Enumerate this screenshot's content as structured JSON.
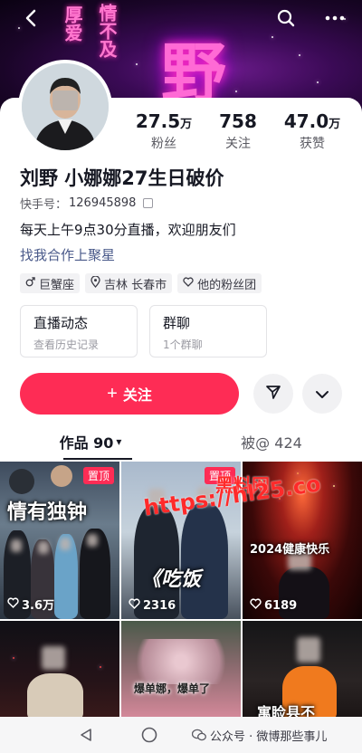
{
  "header": {
    "back_icon": "chevron-left-icon",
    "search_icon": "search-icon",
    "more_icon": "more-horizontal-icon",
    "banner_big_text": "野",
    "banner_text_1": "厚爱",
    "banner_text_2": "情不及"
  },
  "profile": {
    "name": "刘野 小娜娜27生日破价",
    "account_label": "快手号：",
    "account_id": "126945898",
    "bio_line1": "每天上午9点30分直播，欢迎朋友们",
    "bio_line2": "找我合作上聚星",
    "stats": [
      {
        "value": "27.5",
        "unit": "万",
        "label": "粉丝"
      },
      {
        "value": "758",
        "unit": "",
        "label": "关注"
      },
      {
        "value": "47.0",
        "unit": "万",
        "label": "获赞"
      }
    ],
    "tags": [
      {
        "icon": "male-icon",
        "label": "巨蟹座"
      },
      {
        "icon": "location-pin-icon",
        "label": "吉林 长春市"
      },
      {
        "icon": "heart-icon",
        "label": "他的粉丝团"
      }
    ]
  },
  "features": [
    {
      "title": "直播动态",
      "subtitle": "查看历史记录"
    },
    {
      "title": "群聊",
      "subtitle": "1个群聊"
    }
  ],
  "actions": {
    "follow_label": "关注",
    "plus_symbol": "+",
    "share_icon": "send-icon",
    "expand_icon": "chevron-down-icon"
  },
  "tabs": [
    {
      "label": "作品 90",
      "suffix": "▾"
    },
    {
      "label": "被@ 424",
      "suffix": ""
    }
  ],
  "videos": [
    {
      "likes": "3.6万",
      "pinned": "置顶",
      "overlay": "情有独钟"
    },
    {
      "likes": "2316",
      "pinned": "置顶",
      "overlay": "《吃饭"
    },
    {
      "likes": "6189",
      "pinned": "",
      "overlay": "2024健康快乐"
    },
    {
      "likes": "",
      "pinned": "",
      "overlay": ""
    },
    {
      "likes": "",
      "pinned": "",
      "overlay": "爆单娜，爆单了"
    },
    {
      "likes": "",
      "pinned": "",
      "overlay": "寓睑县不"
    }
  ],
  "watermark": {
    "line1": "黑料网",
    "line2": "https://hl25.co"
  },
  "footer": {
    "caption": "公众号 · 微博那些事儿"
  },
  "colors": {
    "accent": "#fe2c55",
    "banner_dark": "#1a0528",
    "banner_glow": "#ff6ad5"
  }
}
